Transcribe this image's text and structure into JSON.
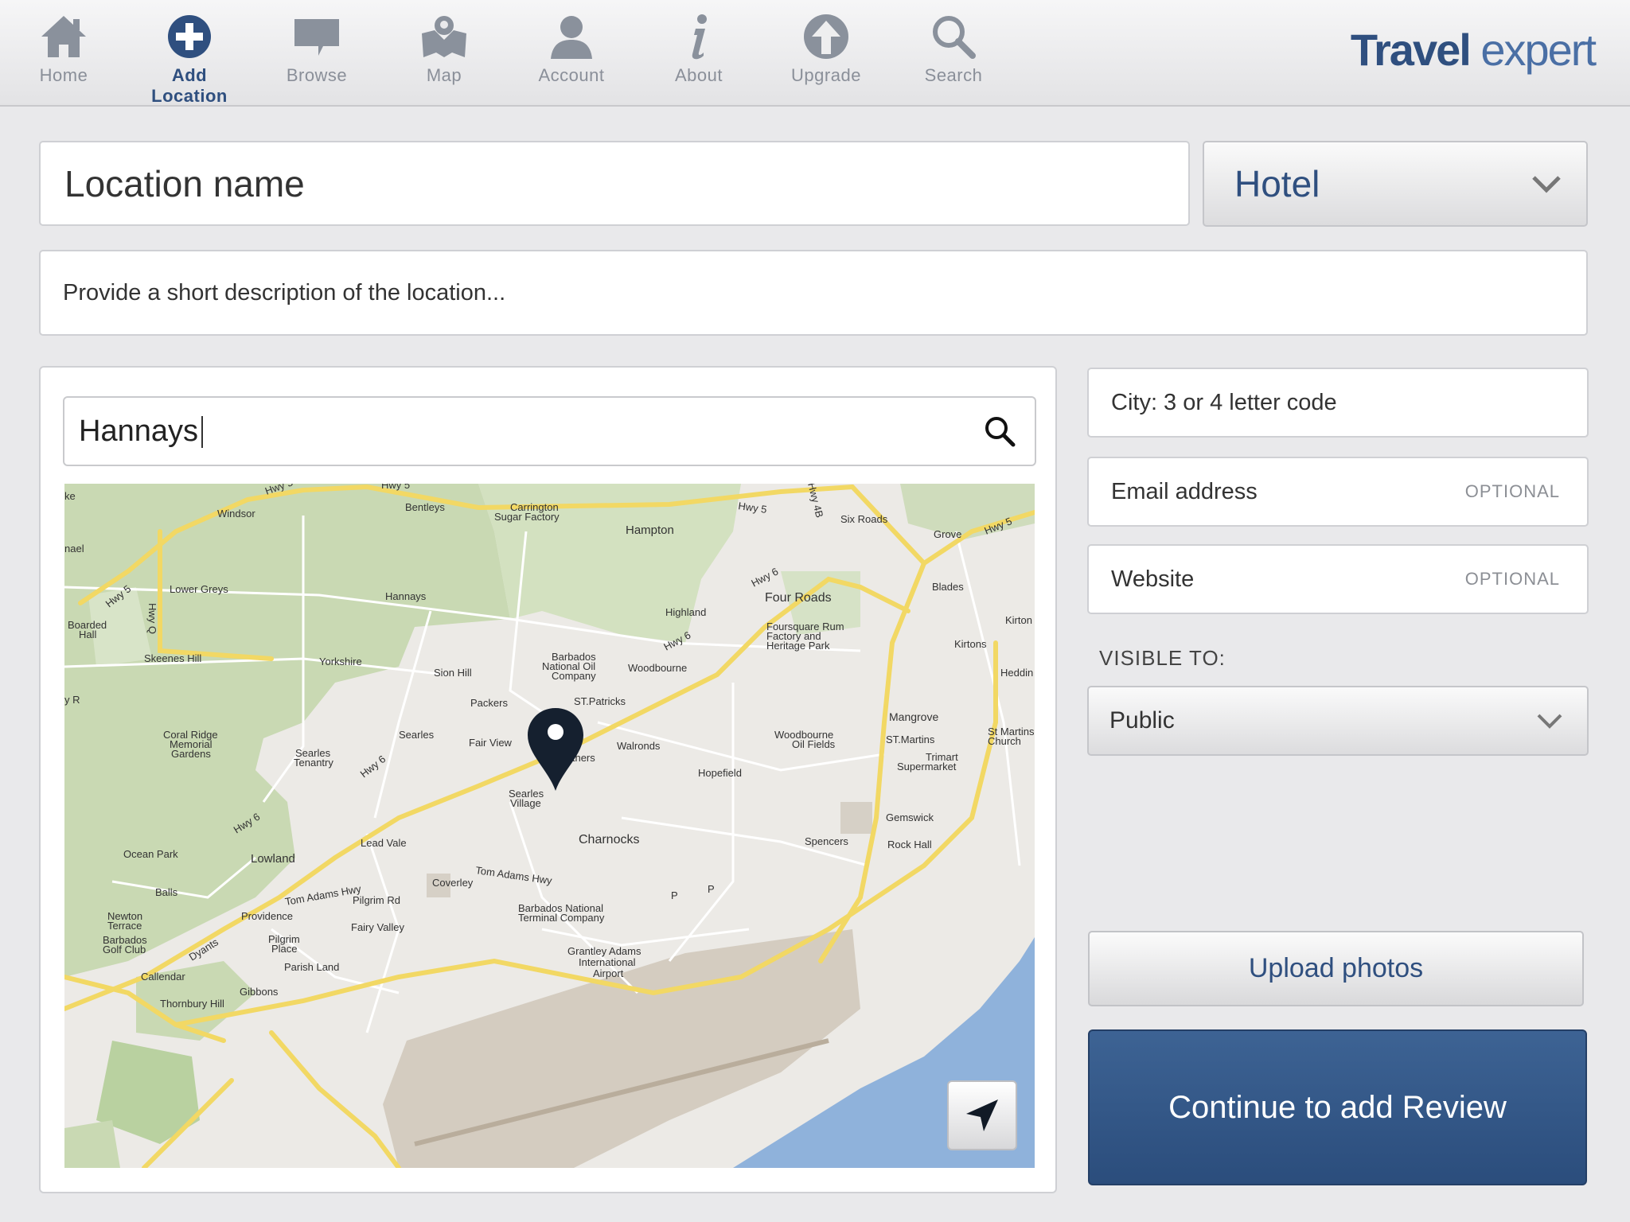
{
  "nav": {
    "items": [
      {
        "label": "Home",
        "icon": "home-icon"
      },
      {
        "label": "Add Location",
        "icon": "plus-circle-icon",
        "active": true
      },
      {
        "label": "Browse",
        "icon": "speech-bubble-icon"
      },
      {
        "label": "Map",
        "icon": "map-pin-icon"
      },
      {
        "label": "Account",
        "icon": "user-icon"
      },
      {
        "label": "About",
        "icon": "info-icon"
      },
      {
        "label": "Upgrade",
        "icon": "upload-arrow-icon"
      },
      {
        "label": "Search",
        "icon": "magnifier-icon"
      }
    ],
    "brand": {
      "part1": "Travel",
      "part2": "expert"
    }
  },
  "form": {
    "location_name_placeholder": "Location name",
    "type_select_value": "Hotel",
    "description_placeholder": "Provide a short description of the location...",
    "map_search_value": "Hannays",
    "city_placeholder": "City: 3 or 4 letter code",
    "email_placeholder": "Email address",
    "email_optional": "OPTIONAL",
    "website_placeholder": "Website",
    "website_optional": "OPTIONAL",
    "visible_to_label": "VISIBLE TO:",
    "visible_to_value": "Public",
    "upload_label": "Upload photos",
    "continue_label": "Continue to add Review"
  },
  "colors": {
    "accent": "#2f4f7f",
    "button_primary": "#35588a",
    "water": "#8fb2db",
    "green_area": "#c9d9b3",
    "road": "#f2d864"
  },
  "map": {
    "labels": {
      "windsor": "Windsor",
      "bentleys": "Bentleys",
      "carrington": "Carrington",
      "sugar_factory": "Sugar Factory",
      "hampton": "Hampton",
      "six_roads": "Six Roads",
      "grove": "Grove",
      "lower_greys": "Lower Greys",
      "hannays": "Hannays",
      "four_roads": "Four Roads",
      "highland": "Highland",
      "blades": "Blades",
      "kirton": "Kirton",
      "kirtons": "Kirtons",
      "boarded": "Boarded",
      "hall": "Hall",
      "skeenes_hill": "Skeenes Hill",
      "yorkshire": "Yorkshire",
      "sion_hill": "Sion Hill",
      "barbados": "Barbados",
      "national_oil": "National Oil",
      "company": "Company",
      "woodbourne": "Woodbourne",
      "foursquare": "Foursquare Rum",
      "factory_and": "Factory and",
      "heritage_park": "Heritage Park",
      "heddin": "Heddin",
      "packers": "Packers",
      "st_patricks": "ST.Patricks",
      "mangrove": "Mangrove",
      "coral_ridge": "Coral Ridge",
      "memorial": "Memorial",
      "gardens": "Gardens",
      "searles": "Searles",
      "fair_view": "Fair View",
      "walronds": "Walronds",
      "lowthers": "Lowthers",
      "woodbourne2": "Woodbourne",
      "oil_fields": "Oil Fields",
      "st_martins": "ST.Martins",
      "st_martins_church1": "St Martins",
      "st_martins_church2": "Church",
      "trimart": "Trimart",
      "supermarket": "Supermarket",
      "searles_tenantry1": "Searles",
      "searles_tenantry2": "Tenantry",
      "hopefield": "Hopefield",
      "searles_village1": "Searles",
      "searles_village2": "Village",
      "gemswick": "Gemswick",
      "lead_vale": "Lead Vale",
      "charnocks": "Charnocks",
      "spencers": "Spencers",
      "rock_hall": "Rock Hall",
      "ocean_park": "Ocean Park",
      "lowland": "Lowland",
      "tom_adams_hwy": "Tom Adams Hwy",
      "coverley": "Coverley",
      "balls": "Balls",
      "pilgrim_rd": "Pilgrim Rd",
      "newton": "Newton",
      "terrace": "Terrace",
      "providence": "Providence",
      "barbados_terminal1": "Barbados National",
      "barbados_terminal2": "Terminal Company",
      "fairy_valley": "Fairy Valley",
      "barbados_golf1": "Barbados",
      "barbados_golf2": "Golf Club",
      "pilgrim_place1": "Pilgrim",
      "pilgrim_place2": "Place",
      "dyants": "Dyants",
      "grantley1": "Grantley Adams",
      "grantley2": "International",
      "grantley3": "Airport",
      "parish_land": "Parish Land",
      "callendar": "Callendar",
      "gibbons": "Gibbons",
      "thornbury": "Thornbury Hill",
      "hwy5": "Hwy 5",
      "hwy6": "Hwy 6",
      "hwy_q": "Hwy Q",
      "hwy4b": "Hwy 4B",
      "ke": "ke",
      "nael": "nael",
      "y_r": "y R",
      "p": "P"
    }
  }
}
